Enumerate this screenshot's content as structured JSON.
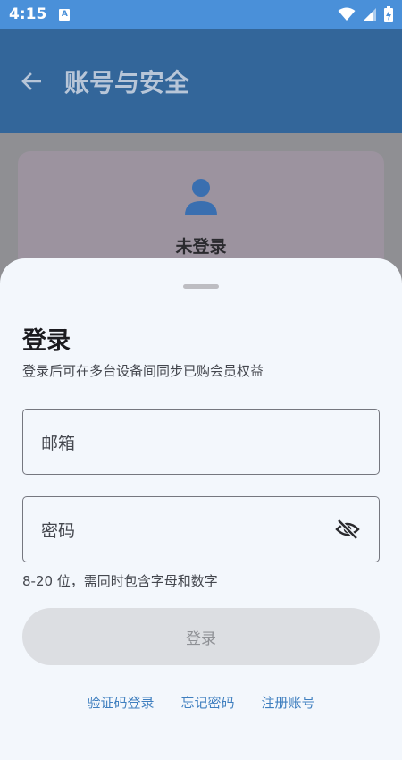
{
  "status_bar": {
    "time": "4:15",
    "notification_badge": "A"
  },
  "app_bar": {
    "title": "账号与安全"
  },
  "account_card": {
    "status": "未登录"
  },
  "sheet": {
    "title": "登录",
    "subtitle": "登录后可在多台设备间同步已购会员权益",
    "email_placeholder": "邮箱",
    "password_placeholder": "密码",
    "password_helper": "8-20 位，需同时包含字母和数字",
    "login_button": "登录",
    "links": {
      "code_login": "验证码登录",
      "forgot_password": "忘记密码",
      "register": "注册账号"
    }
  },
  "icons": {
    "back": "arrow-back-icon",
    "avatar": "person-icon",
    "password_visibility": "visibility-off-icon",
    "wifi": "wifi-icon",
    "signal": "signal-icon",
    "battery": "battery-charging-icon"
  },
  "colors": {
    "status_bar": "#4a90d9",
    "app_bar_dimmed": "#33669a",
    "sheet_background": "#f3f7fc",
    "link": "#3f7fbf",
    "avatar": "#3a6fb0"
  }
}
